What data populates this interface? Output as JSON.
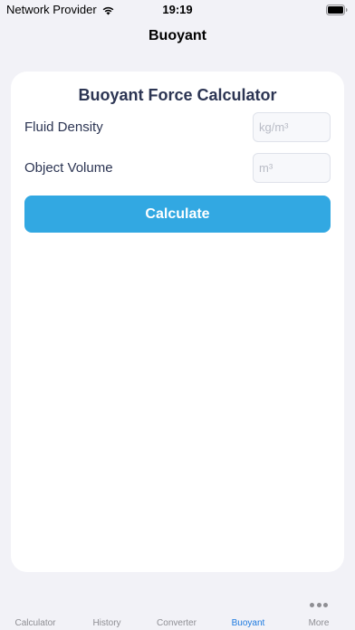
{
  "status_bar": {
    "carrier": "Network Provider",
    "time": "19:19"
  },
  "nav": {
    "title": "Buoyant"
  },
  "card": {
    "title": "Buoyant Force Calculator",
    "fields": [
      {
        "label": "Fluid Density",
        "placeholder": "kg/m³",
        "value": ""
      },
      {
        "label": "Object Volume",
        "placeholder": "m³",
        "value": ""
      }
    ],
    "button_label": "Calculate"
  },
  "tab_bar": {
    "items": [
      {
        "label": "Calculator",
        "active": false
      },
      {
        "label": "History",
        "active": false
      },
      {
        "label": "Converter",
        "active": false
      },
      {
        "label": "Buoyant",
        "active": true
      },
      {
        "label": "More",
        "active": false
      }
    ]
  },
  "colors": {
    "accent": "#32a8e2",
    "active_tab": "#1e7be0",
    "title_text": "#2c3553",
    "background": "#f2f2f7"
  },
  "icons": [
    "wifi-icon",
    "battery-icon",
    "more-icon"
  ]
}
